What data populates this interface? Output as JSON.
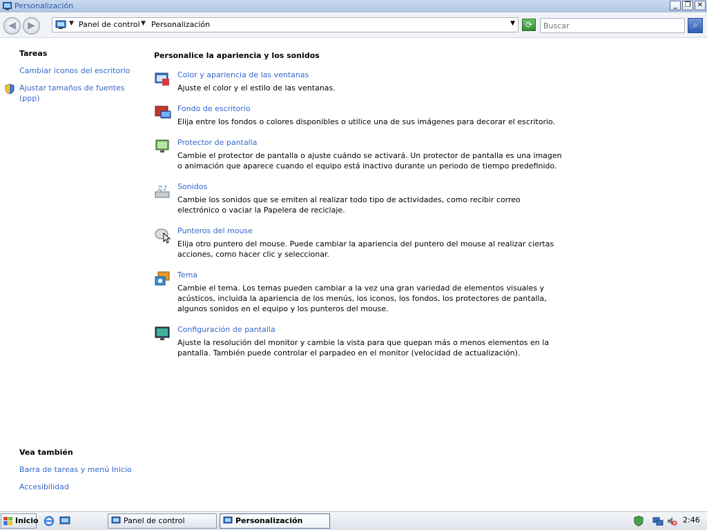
{
  "window": {
    "title": "Personalización",
    "controls": [
      "minimize",
      "restore",
      "close"
    ]
  },
  "navigation": {
    "breadcrumb": [
      "Panel de control",
      "Personalización"
    ],
    "search_placeholder": "Buscar"
  },
  "sidebar": {
    "tasks_heading": "Tareas",
    "tasks": [
      {
        "label": "Cambiar iconos del escritorio",
        "icon": "none"
      },
      {
        "label": "Ajustar tamaños de fuentes (ppp)",
        "icon": "shield-icon"
      }
    ],
    "see_also_heading": "Vea también",
    "see_also": [
      {
        "label": "Barra de tareas y menú Inicio"
      },
      {
        "label": "Accesibilidad"
      }
    ]
  },
  "main": {
    "title": "Personalice la apariencia y los sonidos",
    "items": [
      {
        "icon": "window-color-icon",
        "link": "Color y apariencia de las ventanas",
        "description": "Ajuste el color y el estilo de las ventanas."
      },
      {
        "icon": "desktop-background-icon",
        "link": "Fondo de escritorio",
        "description": "Elija entre los fondos o colores disponibles o utilice una de sus imágenes para decorar el escritorio."
      },
      {
        "icon": "screensaver-icon",
        "link": "Protector de pantalla",
        "description": "Cambie el protector de pantalla o ajuste cuándo se activará. Un protector de pantalla es una imagen o animación que aparece cuando el equipo está inactivo durante un periodo de tiempo predefinido."
      },
      {
        "icon": "sounds-icon",
        "link": "Sonidos",
        "description": "Cambie los sonidos que se emiten al realizar todo tipo de actividades, como recibir correo electrónico o vaciar la Papelera de reciclaje."
      },
      {
        "icon": "mouse-pointer-icon",
        "link": "Punteros del mouse",
        "description": "Elija otro puntero del mouse. Puede cambiar la apariencia del puntero del mouse al realizar ciertas acciones, como hacer clic y seleccionar."
      },
      {
        "icon": "theme-icon",
        "link": "Tema",
        "description": "Cambie el tema. Los temas pueden cambiar a la vez una gran variedad de elementos visuales y acústicos, incluida la apariencia de los menús, los iconos, los fondos, los protectores de pantalla, algunos sonidos en el equipo y los punteros del mouse."
      },
      {
        "icon": "display-settings-icon",
        "link": "Configuración de pantalla",
        "description": "Ajuste la resolución del monitor y cambie la vista para que quepan más o menos elementos en la pantalla. También puede controlar el parpadeo en el monitor (velocidad de actualización)."
      }
    ]
  },
  "taskbar": {
    "start_label": "Inicio",
    "tasks": [
      {
        "label": "Panel de control",
        "active": false
      },
      {
        "label": "Personalización",
        "active": true
      }
    ],
    "clock": "2:46"
  },
  "colors": {
    "link": "#3366cc",
    "titlebar": "#b3c8e6"
  }
}
